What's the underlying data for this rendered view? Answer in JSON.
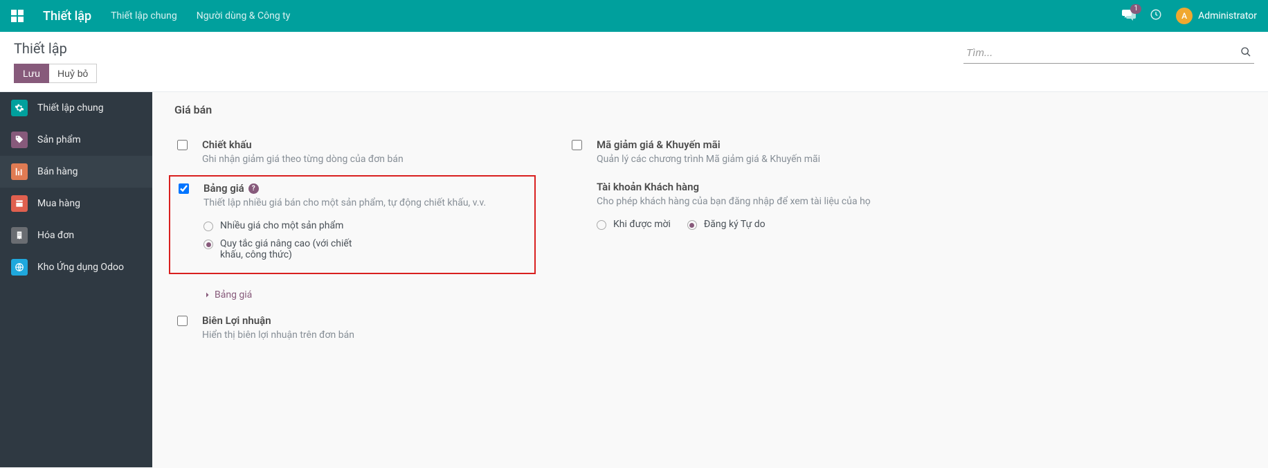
{
  "navbar": {
    "brand": "Thiết lập",
    "links": [
      "Thiết lập chung",
      "Người dùng & Công ty"
    ],
    "badge": "1",
    "avatar_letter": "A",
    "username": "Administrator"
  },
  "control": {
    "title": "Thiết lập",
    "save": "Lưu",
    "discard": "Huỷ bỏ",
    "search_placeholder": "Tìm..."
  },
  "sidebar": {
    "items": [
      {
        "label": "Thiết lập chung"
      },
      {
        "label": "Sản phẩm"
      },
      {
        "label": "Bán hàng"
      },
      {
        "label": "Mua hàng"
      },
      {
        "label": "Hóa đơn"
      },
      {
        "label": "Kho Ứng dụng Odoo"
      }
    ]
  },
  "section": {
    "title": "Giá bán",
    "discount": {
      "title": "Chiết khấu",
      "desc": "Ghi nhận giảm giá theo từng dòng của đơn bán"
    },
    "promo": {
      "title": "Mã giảm giá & Khuyến mãi",
      "desc": "Quản lý các chương trình Mã giảm giá & Khuyến mãi"
    },
    "pricelist": {
      "title": "Bảng giá",
      "desc": "Thiết lập nhiều giá bán cho một sản phẩm, tự động chiết khấu, v.v.",
      "opt1": "Nhiều giá cho một sản phẩm",
      "opt2": "Quy tắc giá nâng cao (với chiết khấu, công thức)",
      "link": "Bảng giá"
    },
    "customer_account": {
      "title": "Tài khoản Khách hàng",
      "desc": "Cho phép khách hàng của bạn đăng nhập để xem tài liệu của họ",
      "opt1": "Khi được mời",
      "opt2": "Đăng ký Tự do"
    },
    "margin": {
      "title": "Biên Lợi nhuận",
      "desc": "Hiển thị biên lợi nhuận trên đơn bán"
    }
  }
}
